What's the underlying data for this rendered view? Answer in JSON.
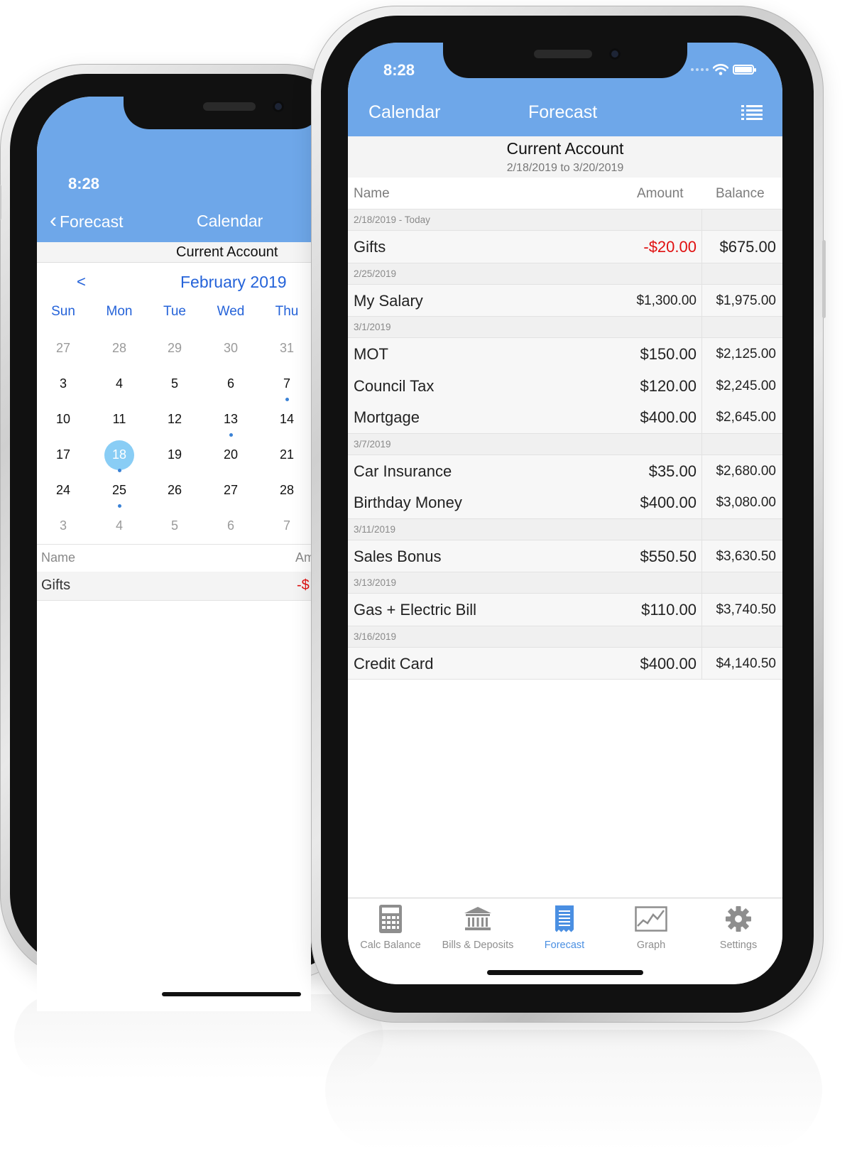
{
  "back_phone": {
    "status_time": "8:28",
    "nav": {
      "back_label": "Forecast",
      "title": "Calendar"
    },
    "account": "Current Account",
    "calendar": {
      "prev": "<",
      "month": "February 2019",
      "weekdays": [
        "Sun",
        "Mon",
        "Tue",
        "Wed",
        "Thu"
      ],
      "weeks": [
        [
          "27",
          "28",
          "29",
          "30",
          "31"
        ],
        [
          "3",
          "4",
          "5",
          "6",
          "7"
        ],
        [
          "10",
          "11",
          "12",
          "13",
          "14"
        ],
        [
          "17",
          "18",
          "19",
          "20",
          "21"
        ],
        [
          "24",
          "25",
          "26",
          "27",
          "28"
        ],
        [
          "3",
          "4",
          "5",
          "6",
          "7"
        ]
      ],
      "selected_day": "18"
    },
    "list": {
      "headers": {
        "name": "Name",
        "amount": "Am"
      },
      "rows": [
        {
          "name": "Gifts",
          "amount": "-$"
        }
      ]
    }
  },
  "front_phone": {
    "status_time": "8:28",
    "nav": {
      "left": "Calendar",
      "title": "Forecast",
      "right_icon": "list-icon"
    },
    "account": {
      "name": "Current Account",
      "range": "2/18/2019 to 3/20/2019"
    },
    "columns": {
      "name": "Name",
      "amount": "Amount",
      "balance": "Balance"
    },
    "groups": [
      {
        "date": "2/18/2019 - Today",
        "items": [
          {
            "name": "Gifts",
            "amount": "-$20.00",
            "balance": "$675.00",
            "negative": true
          }
        ]
      },
      {
        "date": "2/25/2019",
        "items": [
          {
            "name": "My Salary",
            "amount": "$1,300.00",
            "balance": "$1,975.00"
          }
        ]
      },
      {
        "date": "3/1/2019",
        "items": [
          {
            "name": "MOT",
            "amount": "$150.00",
            "balance": "$2,125.00"
          },
          {
            "name": "Council Tax",
            "amount": "$120.00",
            "balance": "$2,245.00"
          },
          {
            "name": "Mortgage",
            "amount": "$400.00",
            "balance": "$2,645.00"
          }
        ]
      },
      {
        "date": "3/7/2019",
        "items": [
          {
            "name": "Car Insurance",
            "amount": "$35.00",
            "balance": "$2,680.00"
          },
          {
            "name": "Birthday Money",
            "amount": "$400.00",
            "balance": "$3,080.00"
          }
        ]
      },
      {
        "date": "3/11/2019",
        "items": [
          {
            "name": "Sales Bonus",
            "amount": "$550.50",
            "balance": "$3,630.50"
          }
        ]
      },
      {
        "date": "3/13/2019",
        "items": [
          {
            "name": "Gas + Electric Bill",
            "amount": "$110.00",
            "balance": "$3,740.50"
          }
        ]
      },
      {
        "date": "3/16/2019",
        "items": [
          {
            "name": "Credit Card",
            "amount": "$400.00",
            "balance": "$4,140.50"
          }
        ]
      }
    ],
    "tabs": [
      {
        "label": "Calc Balance",
        "icon": "calculator-icon"
      },
      {
        "label": "Bills & Deposits",
        "icon": "bank-icon"
      },
      {
        "label": "Forecast",
        "icon": "receipt-icon",
        "active": true
      },
      {
        "label": "Graph",
        "icon": "graph-icon"
      },
      {
        "label": "Settings",
        "icon": "gear-icon"
      }
    ]
  },
  "colors": {
    "nav_blue": "#6ea7e9",
    "link_blue": "#2563d9",
    "tab_active": "#4a8fe2",
    "negative": "#e01010",
    "selected_day": "#89cdf5"
  }
}
